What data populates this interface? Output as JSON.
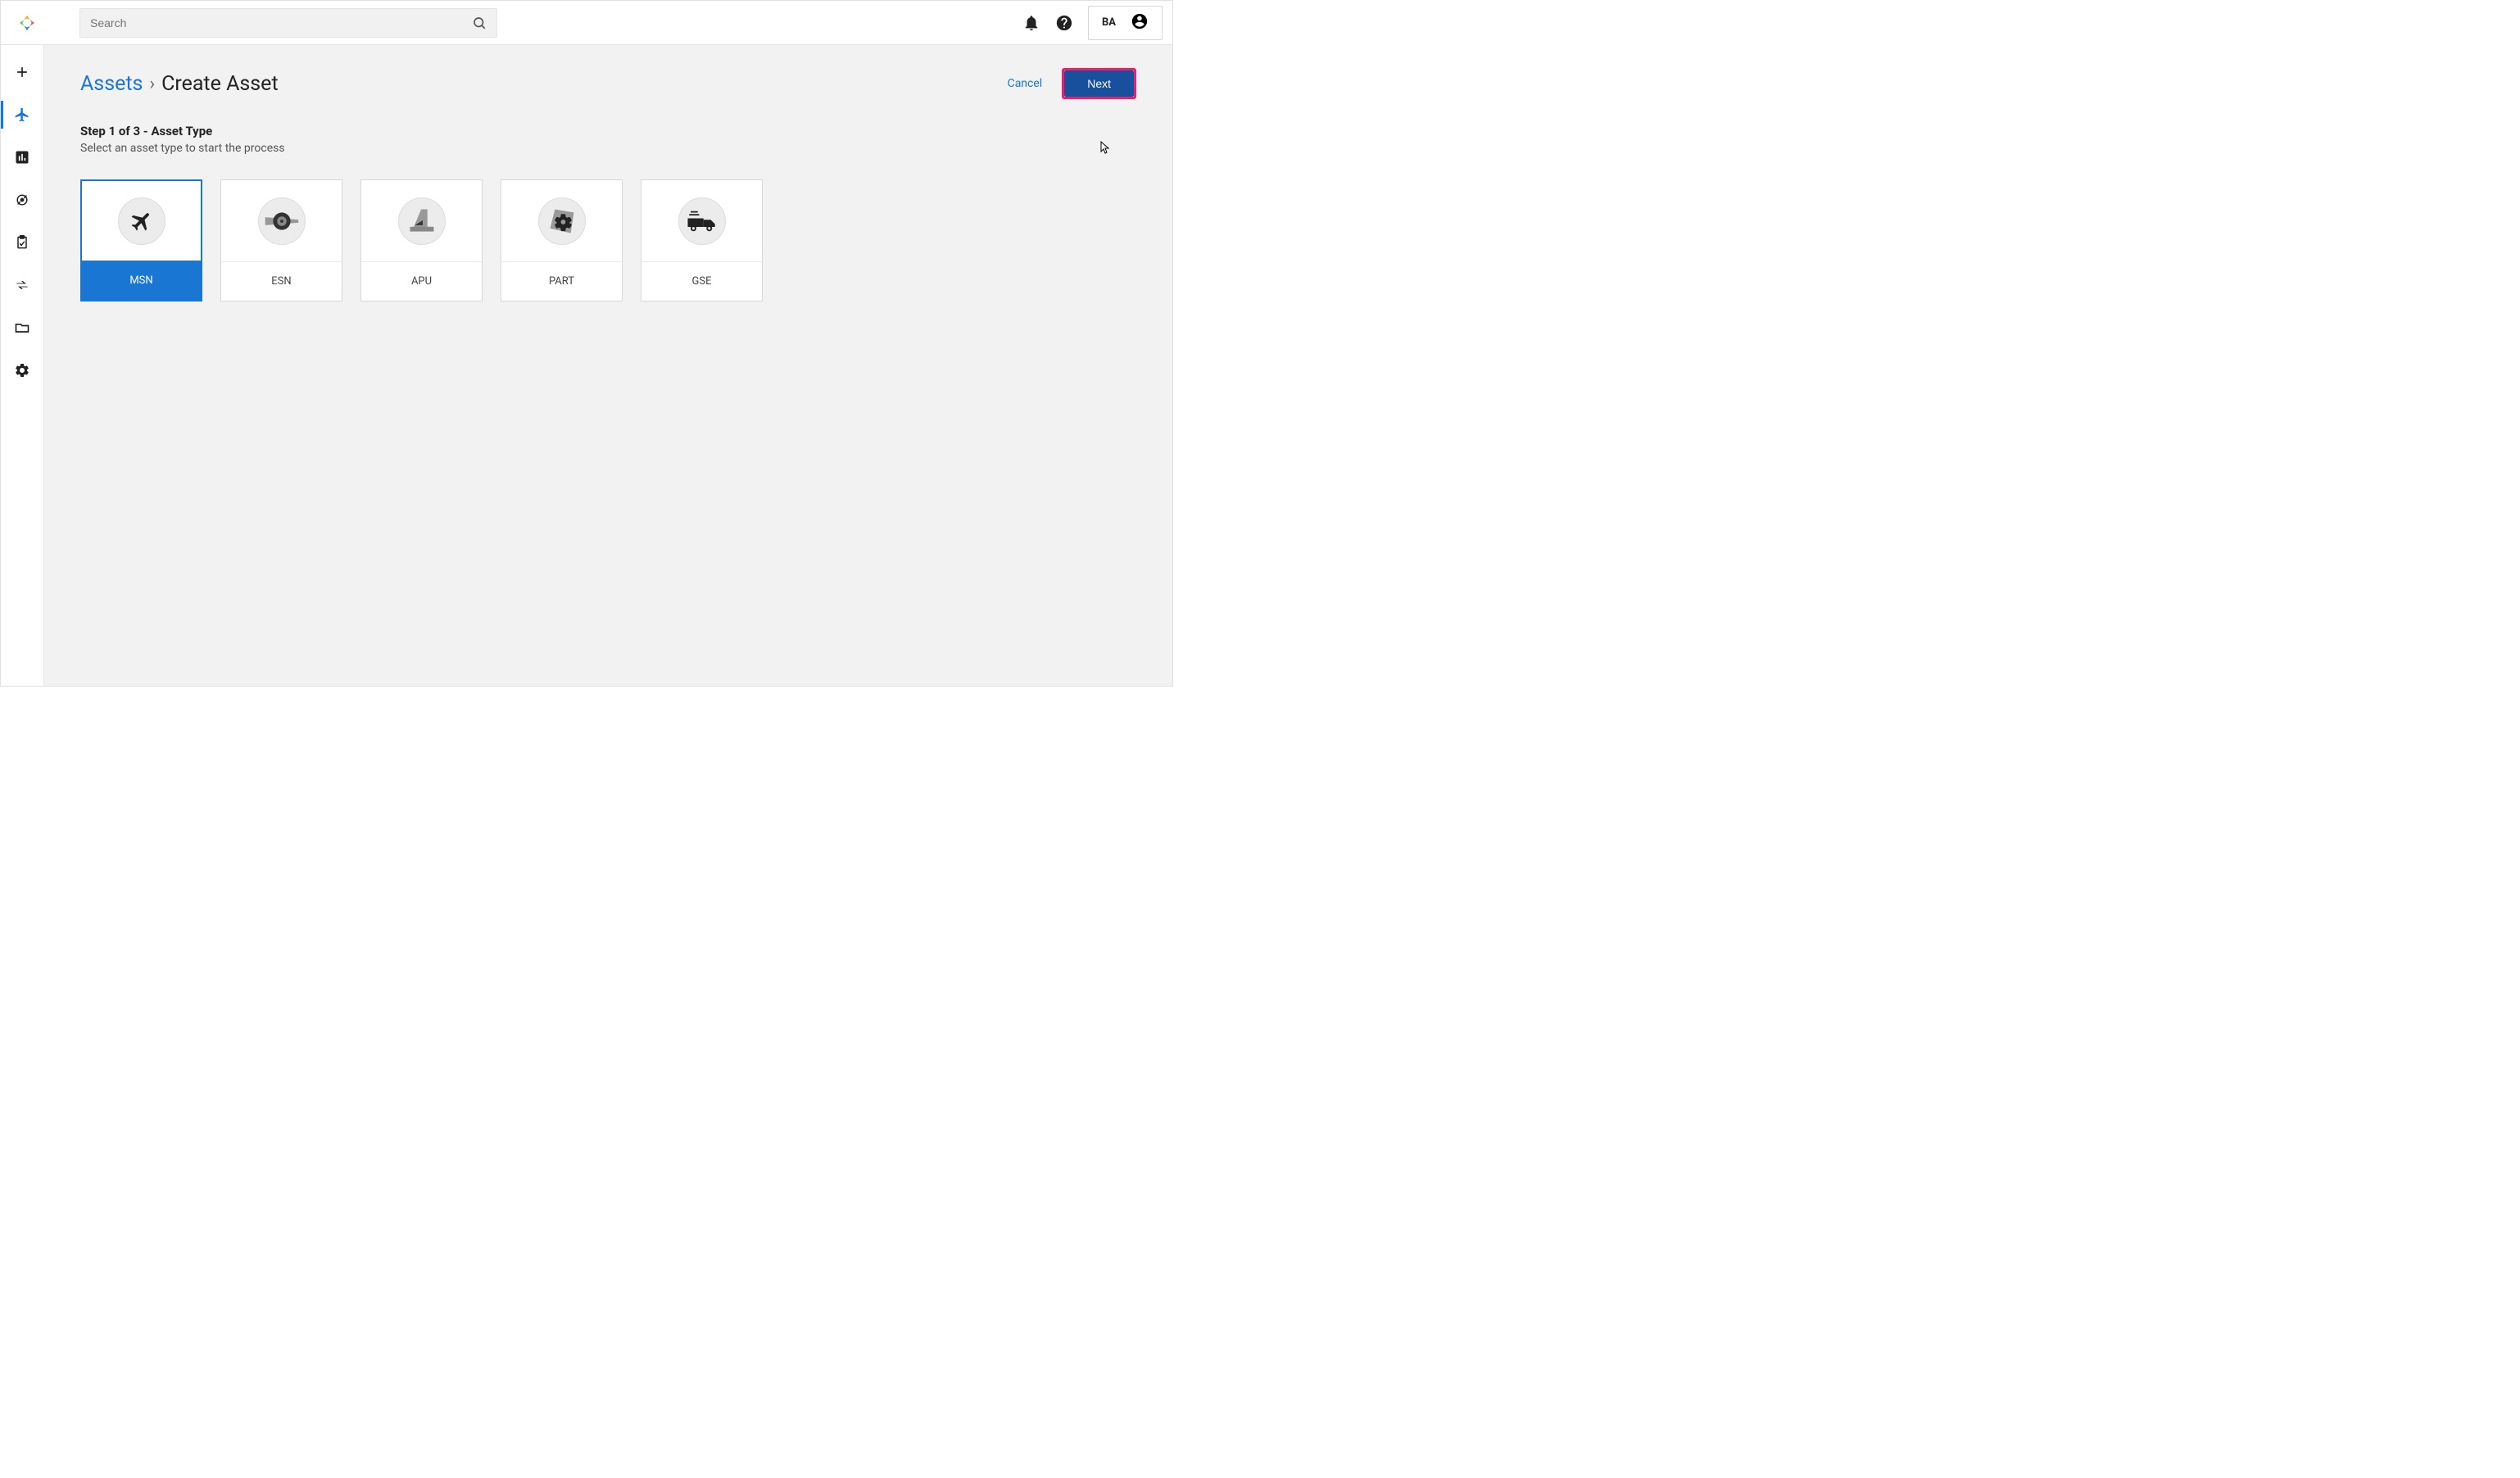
{
  "header": {
    "search_placeholder": "Search",
    "user_label": "BA"
  },
  "breadcrumb": {
    "link": "Assets",
    "separator": "›",
    "current": "Create Asset"
  },
  "actions": {
    "cancel": "Cancel",
    "next": "Next"
  },
  "step": {
    "title": "Step 1 of 3 - Asset Type",
    "description": "Select an asset type to start the process"
  },
  "cards": {
    "items": [
      {
        "label": "MSN",
        "icon": "airplane"
      },
      {
        "label": "ESN",
        "icon": "engine"
      },
      {
        "label": "APU",
        "icon": "tail"
      },
      {
        "label": "PART",
        "icon": "gear"
      },
      {
        "label": "GSE",
        "icon": "truck"
      }
    ]
  }
}
